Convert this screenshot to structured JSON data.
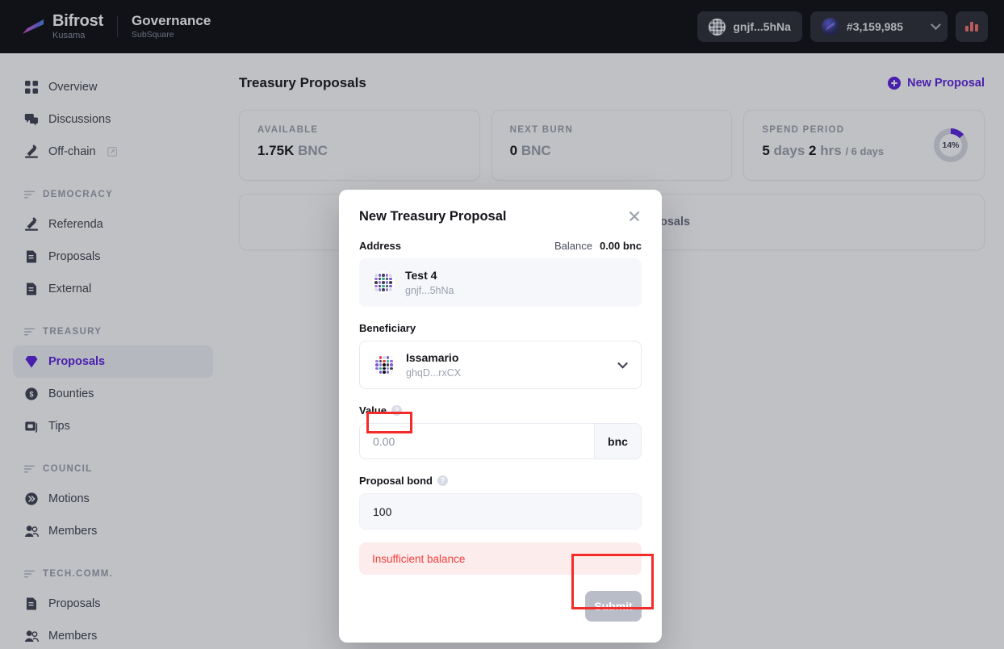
{
  "topbar": {
    "brand_name": "Bifrost",
    "brand_sub": "Kusama",
    "section_title": "Governance",
    "section_sub": "SubSquare",
    "account_pill": "gnjf...5hNa",
    "block_pill": "#3,159,985",
    "accent_color": "#5a21e0"
  },
  "sidebar": {
    "items": [
      {
        "label": "Overview",
        "icon": "grid-icon",
        "type": "item"
      },
      {
        "label": "Discussions",
        "icon": "chat-icon",
        "type": "item"
      },
      {
        "label": "Off-chain",
        "icon": "gavel-icon",
        "type": "item",
        "external": true
      },
      {
        "label": "DEMOCRACY",
        "type": "group"
      },
      {
        "label": "Referenda",
        "icon": "gavel-icon",
        "type": "item"
      },
      {
        "label": "Proposals",
        "icon": "document-icon",
        "type": "item"
      },
      {
        "label": "External",
        "icon": "document-icon",
        "type": "item"
      },
      {
        "label": "TREASURY",
        "type": "group"
      },
      {
        "label": "Proposals",
        "icon": "diamond-icon",
        "type": "item",
        "active": true
      },
      {
        "label": "Bounties",
        "icon": "coin-icon",
        "type": "item"
      },
      {
        "label": "Tips",
        "icon": "tips-icon",
        "type": "item"
      },
      {
        "label": "COUNCIL",
        "type": "group"
      },
      {
        "label": "Motions",
        "icon": "chevrons-right-icon",
        "type": "item"
      },
      {
        "label": "Members",
        "icon": "users-icon",
        "type": "item"
      },
      {
        "label": "TECH.COMM.",
        "type": "group"
      },
      {
        "label": "Proposals",
        "icon": "document-icon",
        "type": "item"
      },
      {
        "label": "Members",
        "icon": "users-icon",
        "type": "item"
      }
    ]
  },
  "main": {
    "page_title": "Treasury Proposals",
    "new_proposal_label": "New Proposal",
    "stats": [
      {
        "label": "AVAILABLE",
        "value": "1.75K",
        "unit": "BNC"
      },
      {
        "label": "NEXT BURN",
        "value": "0",
        "unit": "BNC"
      },
      {
        "label": "SPEND PERIOD",
        "value": "5",
        "unit": "days",
        "value2": "2",
        "unit2": "hrs",
        "total": "/ 6 days",
        "percent": "14%",
        "percent_num": 14
      }
    ],
    "list_card_text": "osals"
  },
  "modal": {
    "title": "New Treasury Proposal",
    "address_label": "Address",
    "balance_label": "Balance",
    "balance_value": "0.00 bnc",
    "account": {
      "name": "Test 4",
      "address": "gnjf...5hNa"
    },
    "beneficiary_label": "Beneficiary",
    "beneficiary": {
      "name": "Issamario",
      "address": "ghqD...rxCX"
    },
    "value_label": "Value",
    "value_placeholder": "0.00",
    "value_unit": "bnc",
    "bond_label": "Proposal bond",
    "bond_value": "100",
    "hint_glyph": "?",
    "error_text": "Insufficient balance",
    "submit_label": "Submit",
    "error_color": "#f1403c"
  }
}
